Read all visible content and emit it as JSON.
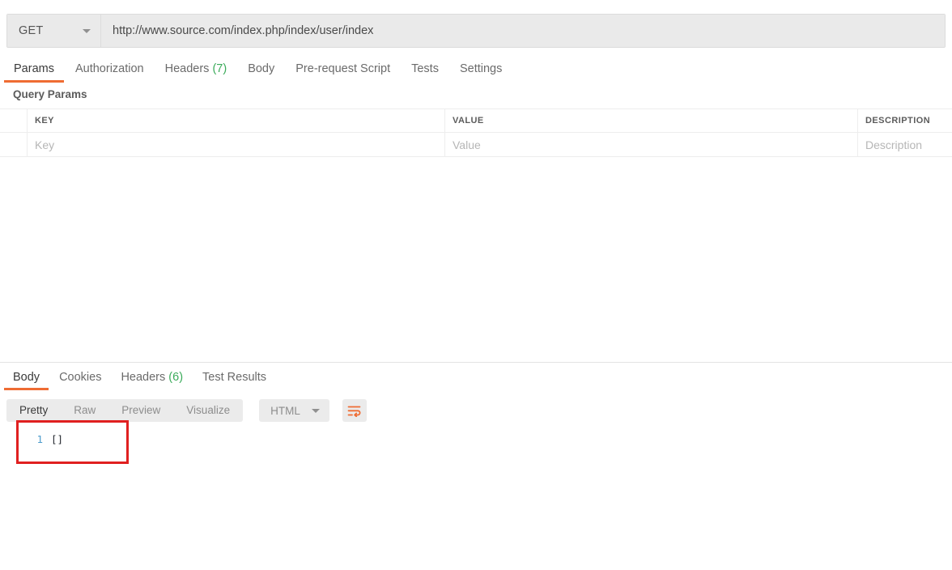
{
  "request": {
    "method": "GET",
    "method_icon": "chevron-down-icon",
    "url": "http://www.source.com/index.php/index/user/index",
    "url_placeholder": "Enter request URL",
    "tabs": [
      {
        "label": "Params",
        "active": true,
        "count": null
      },
      {
        "label": "Authorization",
        "active": false,
        "count": null
      },
      {
        "label": "Headers",
        "active": false,
        "count": "(7)"
      },
      {
        "label": "Body",
        "active": false,
        "count": null
      },
      {
        "label": "Pre-request Script",
        "active": false,
        "count": null
      },
      {
        "label": "Tests",
        "active": false,
        "count": null
      },
      {
        "label": "Settings",
        "active": false,
        "count": null
      }
    ]
  },
  "query_params": {
    "section_title": "Query Params",
    "columns": [
      "KEY",
      "VALUE",
      "DESCRIPTION"
    ],
    "rows": [
      {
        "key": "Key",
        "value": "Value",
        "description": "Description"
      }
    ]
  },
  "response": {
    "tabs": [
      {
        "label": "Body",
        "active": true,
        "count": null
      },
      {
        "label": "Cookies",
        "active": false,
        "count": null
      },
      {
        "label": "Headers",
        "active": false,
        "count": "(6)"
      },
      {
        "label": "Test Results",
        "active": false,
        "count": null
      }
    ],
    "view_modes": [
      {
        "label": "Pretty",
        "active": true
      },
      {
        "label": "Raw",
        "active": false
      },
      {
        "label": "Preview",
        "active": false
      },
      {
        "label": "Visualize",
        "active": false
      }
    ],
    "format": {
      "selected": "HTML",
      "caret_icon": "chevron-down-icon"
    },
    "wrap_icon": "wrap-lines-icon",
    "body": {
      "lines": [
        {
          "number": "1",
          "text": "[]"
        }
      ]
    }
  },
  "colors": {
    "accent": "#ef6c33",
    "count_green": "#3bab5a",
    "annotation_red": "#e02020",
    "linenumber_blue": "#4e9ccc",
    "field_gray": "#eaeaea"
  }
}
